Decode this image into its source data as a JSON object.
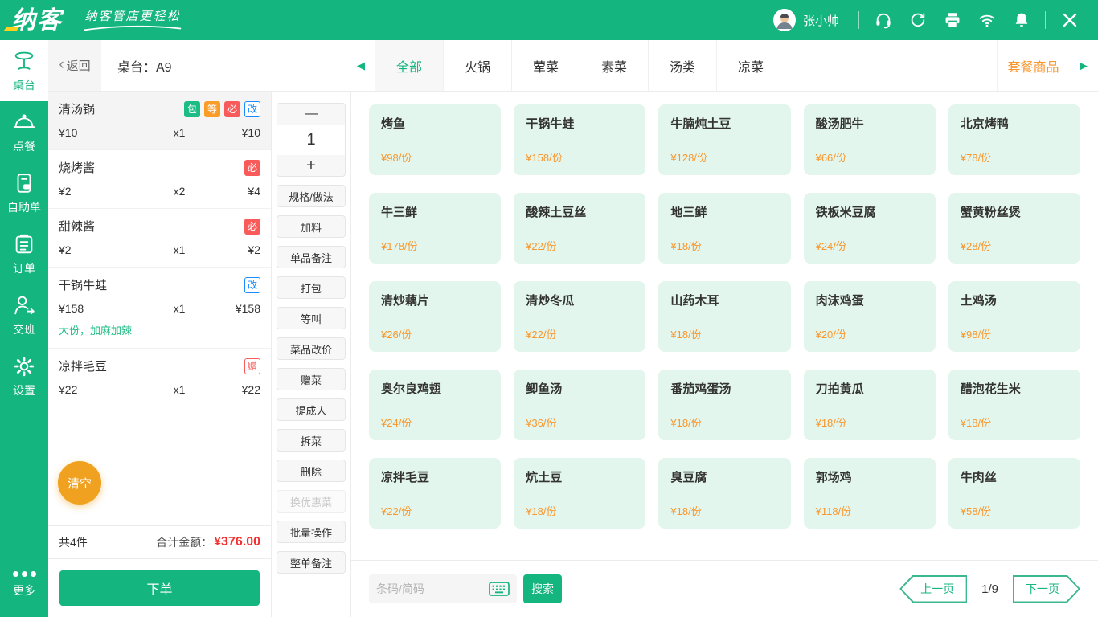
{
  "colors": {
    "primary_green": "#15B57F",
    "card_mint": "#E3F6ED",
    "price_orange": "#F9962C",
    "clear_orange": "#F0A11F",
    "total_red": "#F42F2F",
    "badge_blue": "#1A8CFF",
    "badge_red": "#F95B5B"
  },
  "topbar": {
    "logo": "纳客",
    "slogan": "纳客管店更轻松",
    "user": "张小帅",
    "icon_names": [
      "avatar",
      "support-headset-icon",
      "sync-icon",
      "printer-icon",
      "wifi-icon",
      "bell-icon",
      "close-icon"
    ]
  },
  "sidebar": {
    "items": [
      {
        "label": "桌台",
        "icon": "table-icon",
        "active": true
      },
      {
        "label": "点餐",
        "icon": "cloche-icon"
      },
      {
        "label": "自助单",
        "icon": "self-order-icon"
      },
      {
        "label": "订单",
        "icon": "order-list-icon"
      },
      {
        "label": "交班",
        "icon": "shift-icon"
      },
      {
        "label": "设置",
        "icon": "settings-icon"
      }
    ],
    "more_label": "更多"
  },
  "header": {
    "back_label": "返回",
    "table_label": "桌台：A9",
    "tabs": [
      {
        "label": "全部",
        "active": true
      },
      {
        "label": "火锅"
      },
      {
        "label": "荤菜"
      },
      {
        "label": "素菜"
      },
      {
        "label": "汤类"
      },
      {
        "label": "凉菜"
      }
    ],
    "combo_label": "套餐商品"
  },
  "icons": {
    "back_chevron": "‹",
    "tabs_prev": "◀",
    "tabs_next": "▶"
  },
  "order": {
    "items": [
      {
        "name": "清汤锅",
        "selected": true,
        "badges": [
          {
            "label": "包",
            "style": "solid-green"
          },
          {
            "label": "等",
            "style": "solid-orange"
          },
          {
            "label": "必",
            "style": "solid-red"
          },
          {
            "label": "改",
            "style": "outline-blue"
          }
        ],
        "price": "¥10",
        "qty": "x1",
        "total": "¥10"
      },
      {
        "name": "烧烤酱",
        "badges": [
          {
            "label": "必",
            "style": "solid-red"
          }
        ],
        "price": "¥2",
        "qty": "x2",
        "total": "¥4"
      },
      {
        "name": "甜辣酱",
        "badges": [
          {
            "label": "必",
            "style": "solid-red"
          }
        ],
        "price": "¥2",
        "qty": "x1",
        "total": "¥2"
      },
      {
        "name": "干锅牛蛙",
        "badges": [
          {
            "label": "改",
            "style": "outline-blue"
          }
        ],
        "price": "¥158",
        "qty": "x1",
        "total": "¥158",
        "note": "大份，加麻加辣"
      },
      {
        "name": "凉拌毛豆",
        "badges": [
          {
            "label": "赠",
            "style": "outline-red"
          }
        ],
        "price": "¥22",
        "qty": "x1",
        "total": "¥22"
      }
    ],
    "clear_button": "清空",
    "count_summary": "共4件",
    "total_label": "合计金额：",
    "total_amount": "¥376.00",
    "submit_button": "下单"
  },
  "actions": {
    "minus_label": "—",
    "quantity": "1",
    "plus_label": "+",
    "buttons": [
      {
        "label": "规格/做法"
      },
      {
        "label": "加料"
      },
      {
        "label": "单品备注"
      },
      {
        "label": "打包"
      },
      {
        "label": "等叫"
      },
      {
        "label": "菜品改价"
      },
      {
        "label": "赠菜"
      },
      {
        "label": "提成人"
      },
      {
        "label": "拆菜"
      },
      {
        "label": "删除"
      },
      {
        "label": "换优惠菜",
        "disabled": true
      },
      {
        "label": "批量操作"
      },
      {
        "label": "整单备注"
      }
    ]
  },
  "menu": {
    "items": [
      {
        "name": "烤鱼",
        "price": "¥98/份"
      },
      {
        "name": "干锅牛蛙",
        "price": "¥158/份"
      },
      {
        "name": "牛腩炖土豆",
        "price": "¥128/份"
      },
      {
        "name": "酸汤肥牛",
        "price": "¥66/份"
      },
      {
        "name": "北京烤鸭",
        "price": "¥78/份"
      },
      {
        "name": "牛三鲜",
        "price": "¥178/份"
      },
      {
        "name": "酸辣土豆丝",
        "price": "¥22/份"
      },
      {
        "name": "地三鲜",
        "price": "¥18/份"
      },
      {
        "name": "铁板米豆腐",
        "price": "¥24/份"
      },
      {
        "name": "蟹黄粉丝煲",
        "price": "¥28/份"
      },
      {
        "name": "清炒藕片",
        "price": "¥26/份"
      },
      {
        "name": "清炒冬瓜",
        "price": "¥22/份"
      },
      {
        "name": "山药木耳",
        "price": "¥18/份"
      },
      {
        "name": "肉沫鸡蛋",
        "price": "¥20/份"
      },
      {
        "name": "土鸡汤",
        "price": "¥98/份"
      },
      {
        "name": "奥尔良鸡翅",
        "price": "¥24/份"
      },
      {
        "name": "鲫鱼汤",
        "price": "¥36/份"
      },
      {
        "name": "番茄鸡蛋汤",
        "price": "¥18/份"
      },
      {
        "name": "刀拍黄瓜",
        "price": "¥18/份"
      },
      {
        "name": "醋泡花生米",
        "price": "¥18/份"
      },
      {
        "name": "凉拌毛豆",
        "price": "¥22/份"
      },
      {
        "name": "炕土豆",
        "price": "¥18/份"
      },
      {
        "name": "臭豆腐",
        "price": "¥18/份"
      },
      {
        "name": "郭场鸡",
        "price": "¥118/份"
      },
      {
        "name": "牛肉丝",
        "price": "¥58/份"
      }
    ],
    "search_placeholder": "条码/简码",
    "search_button": "搜索",
    "prev_button": "上一页",
    "page_indicator": "1/9",
    "next_button": "下一页"
  }
}
